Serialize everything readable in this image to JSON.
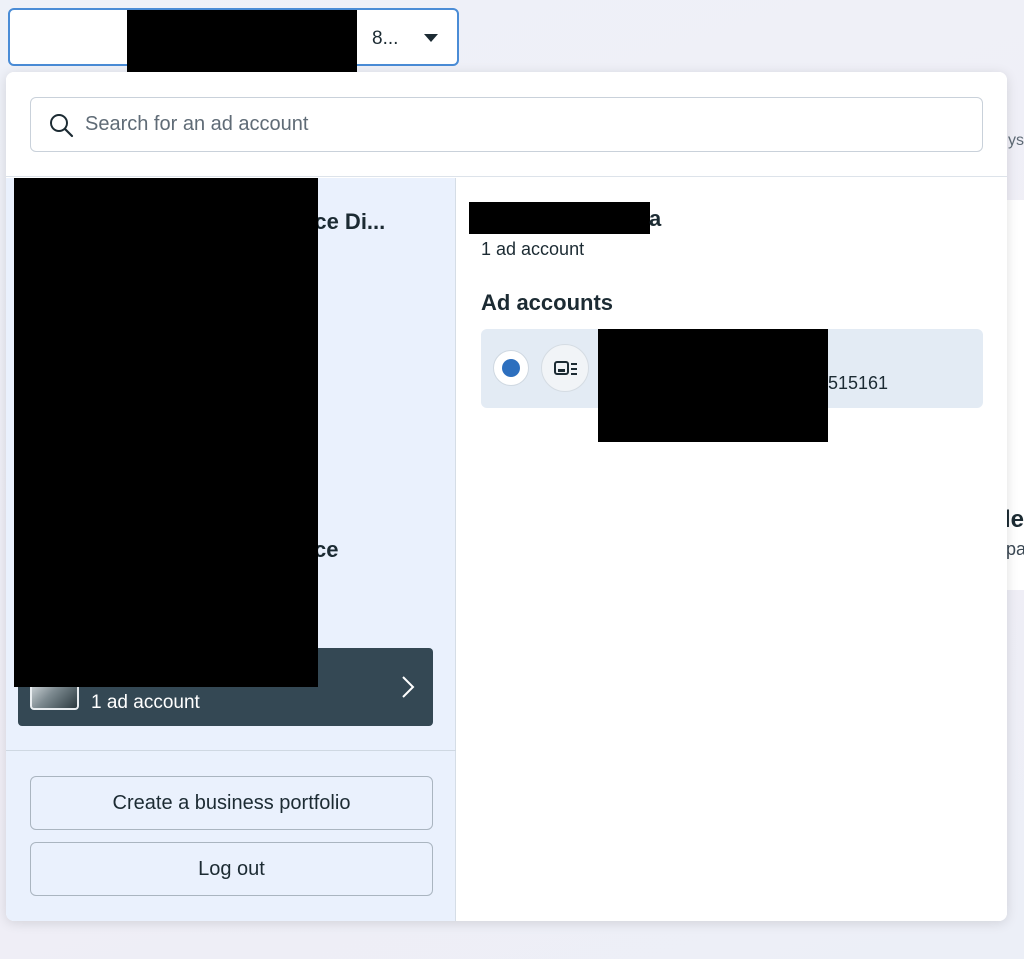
{
  "top_selector": {
    "visible_suffix": "8..."
  },
  "search": {
    "placeholder": "Search for an ad account",
    "value": ""
  },
  "left_panel": {
    "partial_title_1": "vice Di...",
    "partial_title_2": "ce",
    "selected_business": {
      "ad_account_count": "1 ad account"
    },
    "buttons": {
      "create_portfolio": "Create a business portfolio",
      "log_out": "Log out"
    }
  },
  "right_panel": {
    "title_tail": "a",
    "ad_account_count": "1 ad account",
    "section_heading": "Ad accounts",
    "accounts": [
      {
        "id_suffix": "515161",
        "selected": true,
        "icon": "ad-account-icon"
      }
    ]
  },
  "background": {
    "peek_text_1": "ys",
    "peek_text_2": "le",
    "peek_text_3": "pa"
  },
  "colors": {
    "accent": "#2d6fbe",
    "selected_row": "#344854",
    "left_panel_bg": "#eaf1fd",
    "account_row_bg": "#e3ebf4"
  }
}
